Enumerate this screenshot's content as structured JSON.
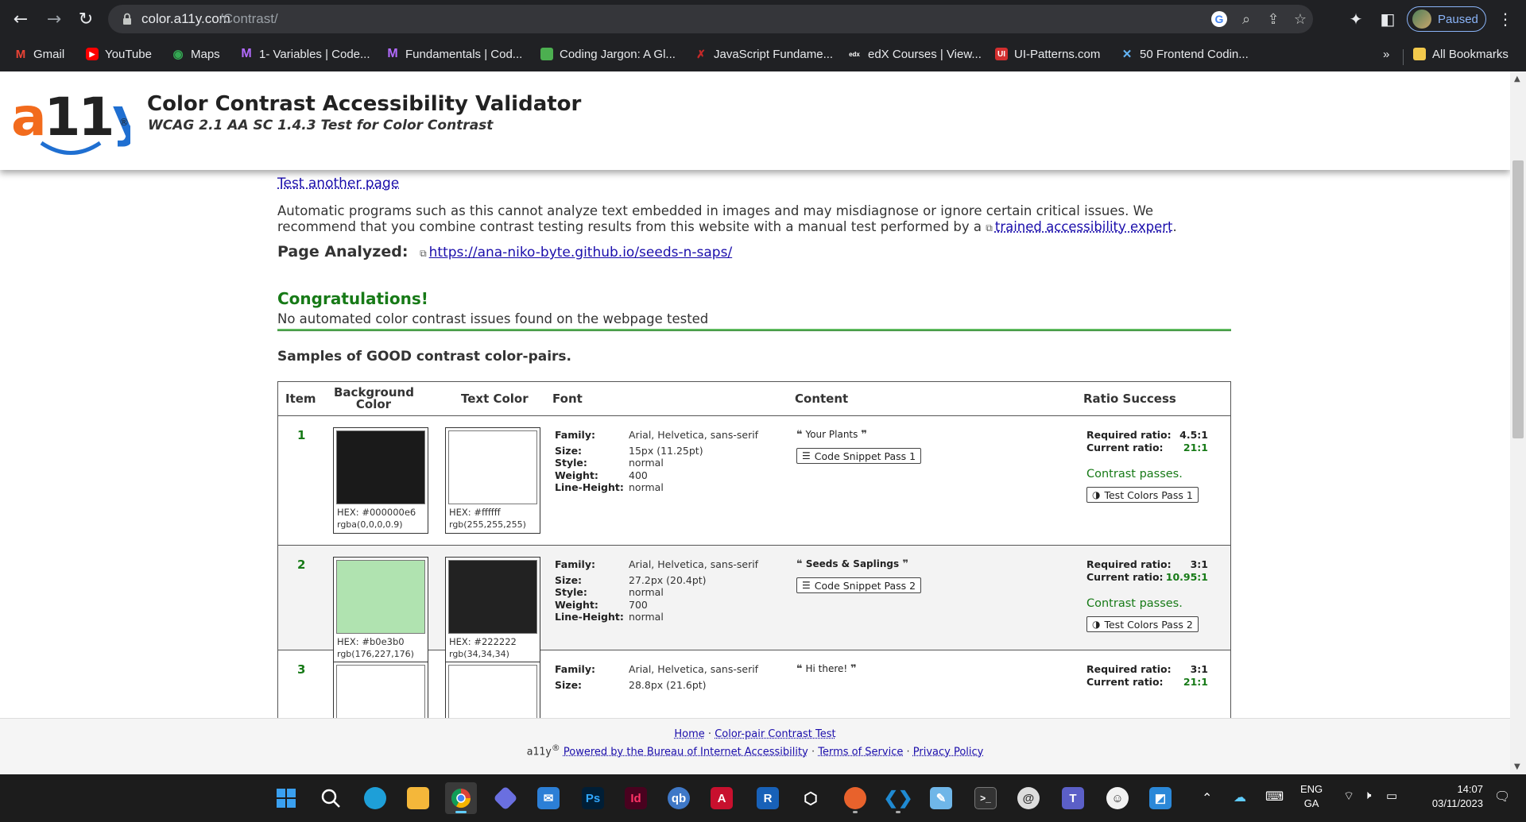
{
  "browser": {
    "url_host": "color.a11y.com",
    "url_path": "/Contrast/",
    "profile_status": "Paused",
    "bookmarks": [
      {
        "label": "Gmail",
        "icon": "gmail-icon",
        "color": "#ea4335"
      },
      {
        "label": "YouTube",
        "icon": "youtube-icon",
        "color": "#ff0000"
      },
      {
        "label": "Maps",
        "icon": "maps-icon",
        "color": "#34a853"
      },
      {
        "label": "1- Variables | Code...",
        "icon": "codecademy-icon",
        "color": "#7b4dff"
      },
      {
        "label": "Fundamentals | Cod...",
        "icon": "codecademy-icon",
        "color": "#7b4dff"
      },
      {
        "label": "Coding Jargon: A Gl...",
        "icon": "doc-icon",
        "color": "#4caf50"
      },
      {
        "label": "JavaScript Fundame...",
        "icon": "x-icon",
        "color": "#c62828"
      },
      {
        "label": "edX Courses | View...",
        "icon": "edx-icon",
        "color": "#ffffff"
      },
      {
        "label": "UI-Patterns.com",
        "icon": "ui-patterns-icon",
        "color": "#d32f2f"
      },
      {
        "label": "50 Frontend Codin...",
        "icon": "frontend-icon",
        "color": "#64b5f6"
      }
    ],
    "bookmarks_overflow": "»",
    "all_bookmarks": "All Bookmarks"
  },
  "header": {
    "logo_text": "a11y",
    "title": "Color Contrast Accessibility Validator",
    "subtitle": "WCAG 2.1 AA SC 1.4.3 Test for Color Contrast"
  },
  "content": {
    "test_another": "Test another page",
    "disclaimer_text": "Automatic programs such as this cannot analyze text embedded in images and may misdiagnose or ignore certain critical issues. We recommend that you combine contrast testing results from this website with a manual test performed by a ",
    "disclaimer_link": "trained accessibility expert",
    "disclaimer_end": ".",
    "page_analyzed_label": "Page Analyzed:",
    "page_analyzed_url": "https://ana-niko-byte.github.io/seeds-n-saps/",
    "congrats_title": "Congratulations!",
    "congrats_message": "No automated color contrast issues found on the webpage tested",
    "samples_heading": "Samples of GOOD contrast color-pairs."
  },
  "table": {
    "headers": {
      "item": "Item",
      "background": "Background Color",
      "text": "Text Color",
      "font": "Font",
      "content": "Content",
      "ratio": "Ratio Success"
    },
    "font_labels": {
      "family": "Family:",
      "size": "Size:",
      "style": "Style:",
      "weight": "Weight:",
      "line_height": "Line-Height:"
    },
    "ratio_labels": {
      "required": "Required ratio:",
      "current": "Current ratio:"
    },
    "rows": [
      {
        "item": "1",
        "bg_color": "#1a1a1a",
        "bg_hex": "HEX: #000000e6",
        "bg_rgb": "rgba(0,0,0,0.9)",
        "text_color": "#ffffff",
        "text_hex": "HEX: #ffffff",
        "text_rgb": "rgb(255,255,255)",
        "family": "Arial, Helvetica, sans-serif",
        "size": "15px (11.25pt)",
        "style": "normal",
        "weight": "400",
        "line_height": "normal",
        "quote_open": "❝",
        "quote_text": "Your Plants",
        "quote_close": "❞",
        "snippet_button": "Code Snippet Pass 1",
        "required_ratio": "4.5:1",
        "current_ratio": "21:1",
        "status": "Contrast passes.",
        "test_button": "Test Colors Pass 1"
      },
      {
        "item": "2",
        "bg_color": "#b0e3b0",
        "bg_hex": "HEX: #b0e3b0",
        "bg_rgb": "rgb(176,227,176)",
        "text_color": "#222222",
        "text_hex": "HEX: #222222",
        "text_rgb": "rgb(34,34,34)",
        "family": "Arial, Helvetica, sans-serif",
        "size": "27.2px (20.4pt)",
        "style": "normal",
        "weight": "700",
        "line_height": "normal",
        "quote_open": "❝",
        "quote_text": "Seeds & Saplings",
        "quote_close": "❞",
        "snippet_button": "Code Snippet Pass 2",
        "required_ratio": "3:1",
        "current_ratio": "10.95:1",
        "status": "Contrast passes.",
        "test_button": "Test Colors Pass 2"
      },
      {
        "item": "3",
        "bg_color": "#ffffff",
        "text_color": "#ffffff",
        "family": "Arial, Helvetica, sans-serif",
        "size": "28.8px (21.6pt)",
        "quote_open": "❝",
        "quote_text": "Hi there!",
        "quote_close": "❞",
        "required_ratio": "3:1",
        "current_ratio": "21:1"
      }
    ]
  },
  "footer": {
    "home": "Home",
    "sep": "·",
    "color_pair": "Color-pair Contrast Test",
    "brand": "a11y",
    "brand_mark": "®",
    "powered": "Powered by the Bureau of Internet Accessibility",
    "terms": "Terms of Service",
    "privacy": "Privacy Policy"
  },
  "taskbar": {
    "apps": [
      {
        "name": "start",
        "glyph": "",
        "color": "#3aa0f0"
      },
      {
        "name": "search",
        "glyph": "",
        "color": "transparent"
      },
      {
        "name": "edge",
        "glyph": "",
        "color": "#1e9fd8"
      },
      {
        "name": "file-explorer",
        "glyph": "",
        "color": "#f4b73a"
      },
      {
        "name": "chrome",
        "glyph": "",
        "color": "#e9a53c"
      },
      {
        "name": "copilot",
        "glyph": "",
        "color": "#6a6fe0"
      },
      {
        "name": "mail",
        "glyph": "",
        "color": "#2c7fd6"
      },
      {
        "name": "photoshop",
        "glyph": "Ps",
        "color": "#001e36"
      },
      {
        "name": "indesign",
        "glyph": "Id",
        "color": "#49021f"
      },
      {
        "name": "qbittorrent",
        "glyph": "qb",
        "color": "#3f78c7"
      },
      {
        "name": "autocad",
        "glyph": "A",
        "color": "#c8102e"
      },
      {
        "name": "revit",
        "glyph": "R",
        "color": "#1861b8"
      },
      {
        "name": "3d-box",
        "glyph": "",
        "color": "transparent"
      },
      {
        "name": "firefox",
        "glyph": "",
        "color": "#e8622c"
      },
      {
        "name": "vscode",
        "glyph": "",
        "color": "#1f8ad2"
      },
      {
        "name": "notepad",
        "glyph": "",
        "color": "#6fb6e8"
      },
      {
        "name": "terminal",
        "glyph": "",
        "color": "#333333"
      },
      {
        "name": "inkscape-swirl",
        "glyph": "",
        "color": "#dddddd"
      },
      {
        "name": "teams",
        "glyph": "",
        "color": "#5b5fc7"
      },
      {
        "name": "emoji",
        "glyph": "",
        "color": "#f2f2f2"
      },
      {
        "name": "sketch",
        "glyph": "",
        "color": "#2b88d8"
      }
    ],
    "language": "ENG",
    "region": "GA",
    "time": "14:07",
    "date": "03/11/2023"
  }
}
